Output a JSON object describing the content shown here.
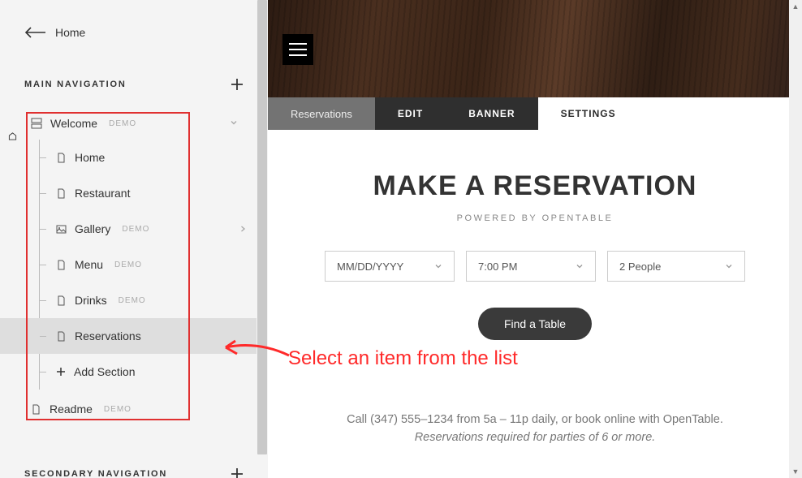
{
  "sidebar": {
    "home": "Home",
    "main_nav_title": "MAIN NAVIGATION",
    "secondary_nav_title": "SECONDARY NAVIGATION",
    "welcome": {
      "label": "Welcome",
      "demo": "DEMO"
    },
    "items": {
      "home": "Home",
      "restaurant": "Restaurant",
      "gallery": {
        "label": "Gallery",
        "demo": "DEMO"
      },
      "menu": {
        "label": "Menu",
        "demo": "DEMO"
      },
      "drinks": {
        "label": "Drinks",
        "demo": "DEMO"
      },
      "reservations": "Reservations",
      "add_section": "Add Section"
    },
    "readme": {
      "label": "Readme",
      "demo": "DEMO"
    }
  },
  "preview": {
    "tabs": {
      "reservations": "Reservations",
      "edit": "EDIT",
      "banner": "BANNER",
      "settings": "SETTINGS"
    },
    "heading": "MAKE A RESERVATION",
    "powered": "POWERED BY OPENTABLE",
    "date_placeholder": "MM/DD/YYYY",
    "time_value": "7:00 PM",
    "people_value": "2 People",
    "find_button": "Find a Table",
    "call_line": "Call (347) 555–1234 from 5a – 11p daily, or book online with OpenTable.",
    "policy_line": "Reservations required for parties of 6 or more."
  },
  "annotation": "Select an item from the list"
}
